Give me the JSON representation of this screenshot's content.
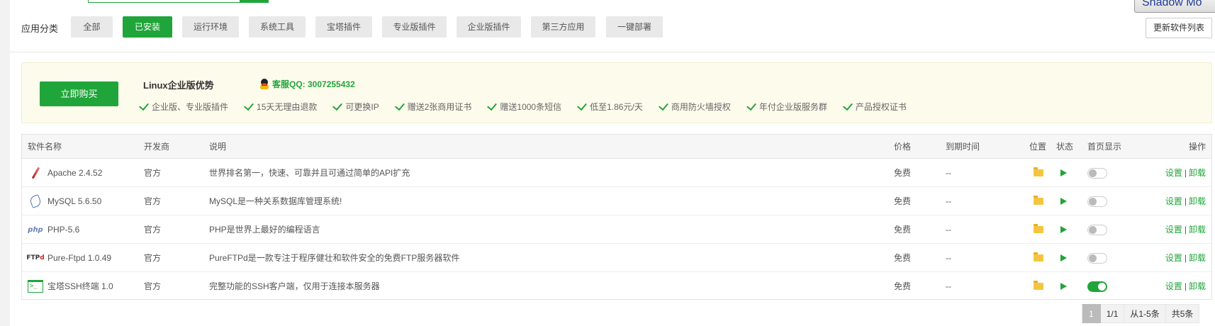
{
  "categories": {
    "label": "应用分类",
    "items": [
      "全部",
      "已安装",
      "运行环境",
      "系统工具",
      "宝塔插件",
      "专业版插件",
      "企业版插件",
      "第三方应用",
      "一键部署"
    ],
    "active_index": 1
  },
  "top_right": {
    "shadow_mode": "Shadow Mo",
    "refresh": "更新软件列表"
  },
  "promo": {
    "buy": "立即购买",
    "title": "Linux企业版优势",
    "qq": "客服QQ: 3007255432",
    "features": [
      "企业版、专业版插件",
      "15天无理由退款",
      "可更换IP",
      "赠送2张商用证书",
      "赠送1000条短信",
      "低至1.86元/天",
      "商用防火墙授权",
      "年付企业版服务群",
      "产品授权证书"
    ]
  },
  "table": {
    "headers": {
      "name": "软件名称",
      "developer": "开发商",
      "desc": "说明",
      "price": "价格",
      "expiry": "到期时间",
      "location": "位置",
      "status": "状态",
      "homepage": "首页显示",
      "actions": "操作"
    },
    "rows": [
      {
        "icon": "apache-feather-icon",
        "name": "Apache 2.4.52",
        "developer": "官方",
        "desc": "世界排名第一，快速、可靠并且可通过简单的API扩充",
        "price": "免费",
        "expiry": "--",
        "homepage": false,
        "settings": "设置",
        "uninstall": "卸载"
      },
      {
        "icon": "mysql-dolphin-icon",
        "name": "MySQL 5.6.50",
        "developer": "官方",
        "desc": "MySQL是一种关系数据库管理系统!",
        "price": "免费",
        "expiry": "--",
        "homepage": false,
        "settings": "设置",
        "uninstall": "卸载"
      },
      {
        "icon": "php-logo-icon",
        "name": "PHP-5.6",
        "developer": "官方",
        "desc": "PHP是世界上最好的编程语言",
        "price": "免费",
        "expiry": "--",
        "homepage": false,
        "settings": "设置",
        "uninstall": "卸载"
      },
      {
        "icon": "ftp-logo-icon",
        "name": "Pure-Ftpd 1.0.49",
        "developer": "官方",
        "desc": "PureFTPd是一款专注于程序健壮和软件安全的免费FTP服务器软件",
        "price": "免费",
        "expiry": "--",
        "homepage": false,
        "settings": "设置",
        "uninstall": "卸载"
      },
      {
        "icon": "terminal-icon",
        "name": "宝塔SSH终端 1.0",
        "developer": "官方",
        "desc": "完整功能的SSH客户端，仅用于连接本服务器",
        "price": "免费",
        "expiry": "--",
        "homepage": true,
        "settings": "设置",
        "uninstall": "卸载"
      }
    ]
  },
  "pagination": {
    "current": "1",
    "pages": "1/1",
    "range": "从1-5条",
    "total": "共5条"
  },
  "icon_text": {
    "php": "php",
    "ftp_prefix": "FTP",
    "ftp_suffix": "d",
    "terminal": ">_"
  },
  "colors": {
    "accent": "#20a53a",
    "promo_bg": "#fdfbec",
    "folder": "#f4c542"
  }
}
